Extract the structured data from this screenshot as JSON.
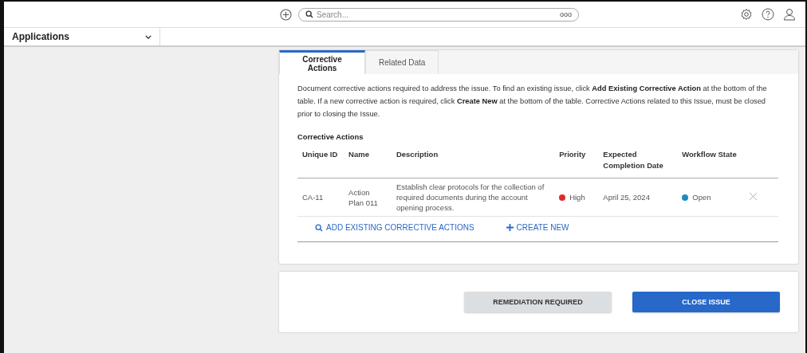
{
  "header": {
    "search": {
      "placeholder": "Search..."
    },
    "search_more": "ooo"
  },
  "app_bar": {
    "label": "Applications"
  },
  "tabs": [
    {
      "label": "Corrective Actions",
      "selected": true
    },
    {
      "label": "Related Data",
      "selected": false
    }
  ],
  "intro": "Document corrective actions required to address the issue. To find an existing issue, click **Add Existing Corrective Action** at the bottom of the table. If a new corrective action is required, click **Create New** at the bottom of the table. Corrective Actions related to this Issue, must be closed prior to closing the Issue.",
  "table": {
    "title": "Corrective Actions",
    "columns": [
      "Unique ID",
      "Name",
      "Description",
      "Priority",
      "Expected Completion Date",
      "Workflow State"
    ],
    "rows": [
      {
        "id": "CA-11",
        "name": "Action Plan 011",
        "description": "Establish clear protocols for the collection of required documents during the account opening process.",
        "priority": {
          "label": "High",
          "color": "#e02a2a"
        },
        "date": "April 25, 2024",
        "state": {
          "label": "Open",
          "color": "#1b8bc0"
        }
      }
    ]
  },
  "table_actions": [
    "ADD EXISTING CORRECTIVE ACTIONS",
    "CREATE NEW"
  ],
  "buttons": [
    {
      "label": "REMEDIATION REQUIRED",
      "kind": "secondary"
    },
    {
      "label": "CLOSE ISSUE",
      "kind": "primary"
    }
  ]
}
